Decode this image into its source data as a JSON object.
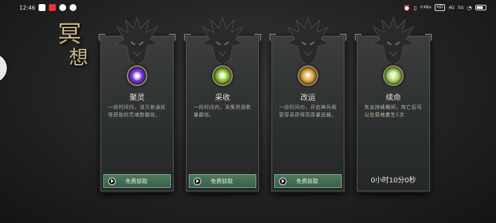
{
  "status_bar": {
    "time": "12:46",
    "icons_left": [
      "mail-icon",
      "red-app-icon",
      "app-icon",
      "sync-icon"
    ],
    "icons_right": [
      "alarm-icon",
      "vibrate-icon",
      "speed-icon",
      "hd-icon",
      "signal-4g-icon",
      "signal-5g-icon",
      "wifi-icon",
      "battery-icon"
    ],
    "net_speed": "0 KB/s",
    "hd_label": "HD",
    "sig1": "4G",
    "sig2": "5G"
  },
  "title": {
    "char1": "冥",
    "char2": "想"
  },
  "colors": {
    "button_green": "#3f6a50",
    "title_gold": "#cbb58d"
  },
  "cards": [
    {
      "name": "聚灵",
      "icon": "purple-orb-icon",
      "desc": "一段时间内，消灭普通妖怪获取的灵魂数翻倍。",
      "button_label": "免费获取"
    },
    {
      "name": "采收",
      "icon": "green-leaf-icon",
      "desc": "一段时间内，采集资源数量翻倍。",
      "button_label": "免费获取"
    },
    {
      "name": "改运",
      "icon": "gold-fortune-icon",
      "desc": "一段时间内，开启神兵阁更容易获得高质量武器。",
      "button_label": "免费获取"
    },
    {
      "name": "续命",
      "icon": "green-figure-icon",
      "desc": "失去持续期间，阵亡后可以在原地重生1次",
      "timer": "0小时10分0秒"
    }
  ]
}
